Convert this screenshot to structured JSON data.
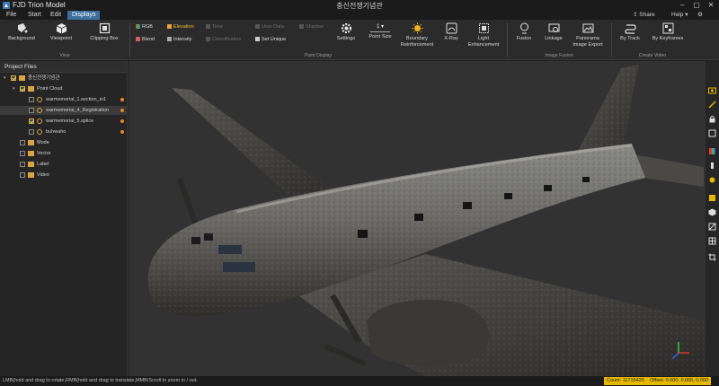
{
  "window": {
    "app_title": "FJD Trion Model",
    "project_title": "충신전쟁기념관",
    "minimize_icon": "minimize-icon",
    "maximize_icon": "maximize-icon",
    "close_icon": "close-icon"
  },
  "menu": {
    "items": [
      "File",
      "Start",
      "Edit",
      "Displays"
    ],
    "active": "Displays",
    "share": "Share",
    "help": "Help"
  },
  "ribbon": {
    "view_group": {
      "label": "View",
      "background": "Background",
      "viewpoint": "Viewpoint",
      "clipping_box": "Clipping Box"
    },
    "point_display": {
      "label": "Point Display",
      "rgb": "RGB",
      "elevation": "Elevation",
      "time": "Time",
      "user_data": "User Data",
      "shadow": "Shadow",
      "blend": "Blend",
      "intensity": "Intensity",
      "classification": "Classification",
      "set_unique": "Set Unique",
      "settings": "Settings",
      "point_size": "Point Size",
      "point_size_value": "1",
      "boundary_line1": "Boundary",
      "boundary_line2": "Reinforcement",
      "xray": "X-Ray",
      "light_line1": "Light",
      "light_line2": "Enhancement"
    },
    "image_fusion": {
      "label": "Image Fusion",
      "fusion": "Fusion",
      "linkage": "Linkage",
      "panorama_line1": "Panorama",
      "panorama_line2": "Image Export"
    },
    "create_video": {
      "label": "Create Video",
      "by_track": "By Track",
      "by_keyframes": "By Keyframes"
    }
  },
  "project_panel": {
    "title": "Project Files",
    "tree": [
      {
        "label": "충신전쟁기념관",
        "level": 0,
        "checked": true,
        "expanded": true
      },
      {
        "label": "Point Cloud",
        "level": 1,
        "checked": true,
        "expanded": true
      },
      {
        "label": "warmemorial_1.section_in1",
        "level": 2,
        "checked": false,
        "dot": true
      },
      {
        "label": "warmemorial_4_Registration",
        "level": 2,
        "checked": false,
        "dot": true,
        "selected": true
      },
      {
        "label": "warmemorial_5.splice",
        "level": 2,
        "checked": true,
        "dot": true
      },
      {
        "label": "buhwaho",
        "level": 2,
        "checked": false,
        "dot": true
      },
      {
        "label": "Mode",
        "level": 1,
        "checked": false
      },
      {
        "label": "Vector",
        "level": 1,
        "checked": false
      },
      {
        "label": "Label",
        "level": 1,
        "checked": false
      },
      {
        "label": "Video",
        "level": 1,
        "checked": false
      }
    ]
  },
  "status": {
    "tip": "LMB(hold and drag to rotate,RMB(hold and drag to translate,MMB/Scroll to zoom in / out.",
    "count": "Count: 11715425",
    "offset": "Offset: 0.000, 0.000, 0.000"
  },
  "colors": {
    "accent": "#3c6e9e",
    "highlight": "#e6b800",
    "dot": "#e8862a"
  }
}
